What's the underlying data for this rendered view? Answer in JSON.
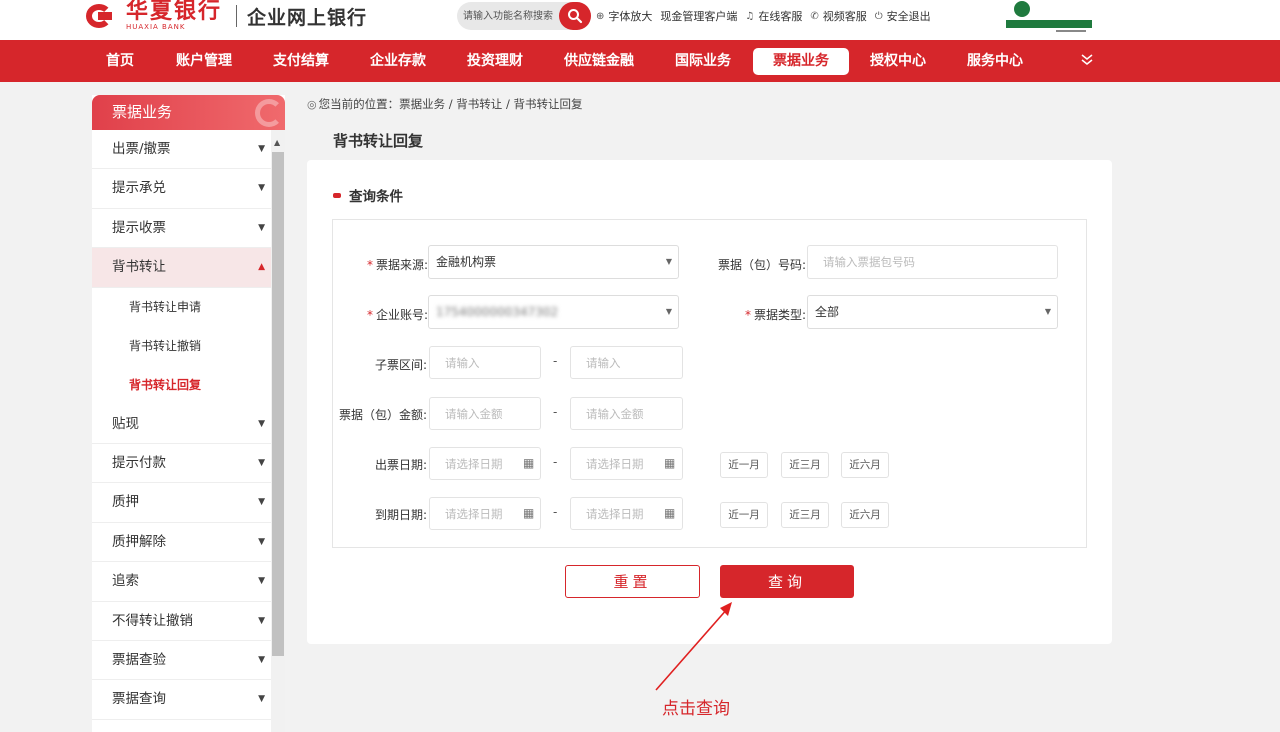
{
  "header": {
    "bank_name": "华夏银行",
    "bank_name_en": "HUAXIA BANK",
    "portal_title": "企业网上银行",
    "search_placeholder": "请输入功能名称搜索",
    "links": [
      {
        "icon": "zoom-icon",
        "label": "字体放大"
      },
      {
        "icon": "none",
        "label": "现金管理客户端"
      },
      {
        "icon": "headset-icon",
        "label": "在线客服"
      },
      {
        "icon": "phone-icon",
        "label": "视频客服"
      },
      {
        "icon": "power-icon",
        "label": "安全退出"
      }
    ]
  },
  "nav": {
    "items": [
      "首页",
      "账户管理",
      "支付结算",
      "企业存款",
      "投资理财",
      "供应链金融",
      "国际业务",
      "票据业务",
      "授权中心",
      "服务中心"
    ],
    "active_index": 7,
    "more_icon": "double-chevron-down-icon"
  },
  "sidebar": {
    "title": "票据业务",
    "items": [
      {
        "label": "出票/撤票"
      },
      {
        "label": "提示承兑"
      },
      {
        "label": "提示收票"
      },
      {
        "label": "背书转让",
        "expanded": true,
        "children": [
          "背书转让申请",
          "背书转让撤销",
          "背书转让回复"
        ],
        "current_child": 2
      },
      {
        "label": "贴现"
      },
      {
        "label": "提示付款"
      },
      {
        "label": "质押"
      },
      {
        "label": "质押解除"
      },
      {
        "label": "追索"
      },
      {
        "label": "不得转让撤销"
      },
      {
        "label": "票据查验"
      },
      {
        "label": "票据查询"
      }
    ]
  },
  "breadcrumb": "您当前的位置：票据业务 / 背书转让 / 背书转让回复",
  "page_title": "背书转让回复",
  "form": {
    "section_title": "查询条件",
    "source_label": "票据来源:",
    "source_value": "金融机构票",
    "package_no_label": "票据（包）号码:",
    "package_no_placeholder": "请输入票据包号码",
    "account_label": "企业账号:",
    "account_value": "1754000000347302",
    "type_label": "票据类型:",
    "type_value": "全部",
    "sub_range_label": "子票区间:",
    "sub_range_placeholder": "请输入",
    "amount_label": "票据（包）金额:",
    "amount_placeholder": "请输入金额",
    "issue_date_label": "出票日期:",
    "due_date_label": "到期日期:",
    "date_placeholder": "请选择日期",
    "quick_ranges": [
      "近一月",
      "近三月",
      "近六月"
    ],
    "range_separator": "-",
    "reset_label": "重置",
    "query_label": "查询"
  },
  "annotation": {
    "text": "点击查询",
    "color": "#e02020"
  },
  "colors": {
    "brand_red": "#d6262b",
    "partner_green": "#1f7a3e"
  }
}
